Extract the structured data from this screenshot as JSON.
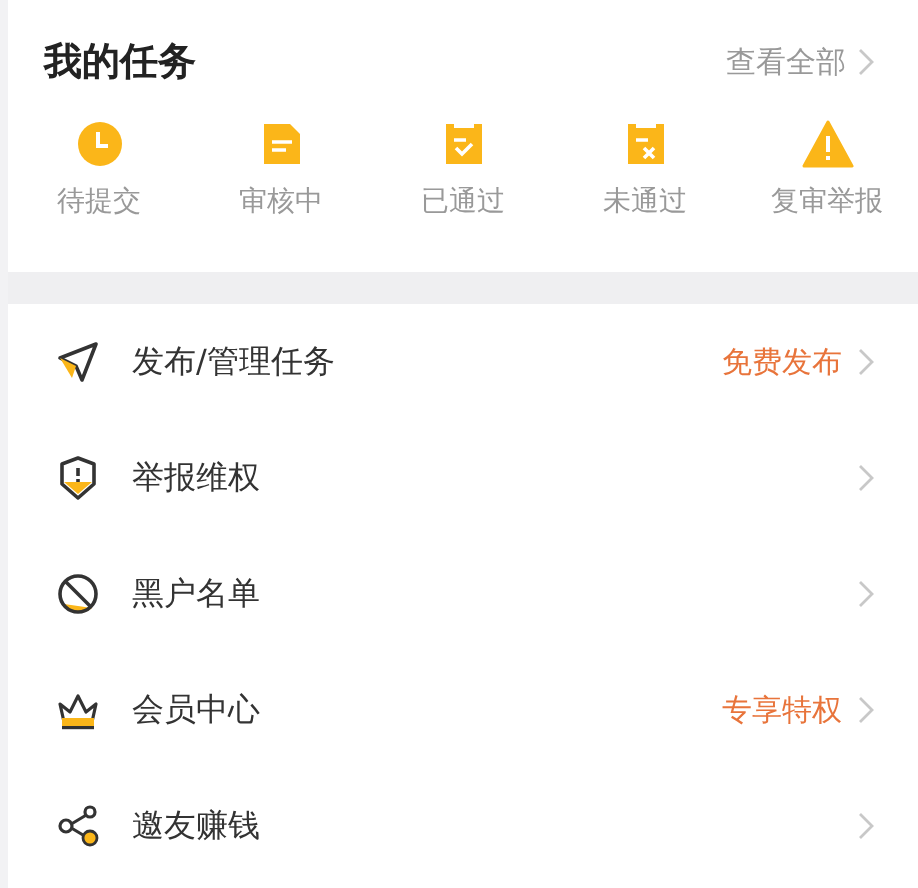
{
  "tasks": {
    "title": "我的任务",
    "view_all": "查看全部",
    "statuses": [
      {
        "kind": "clock",
        "label": "待提交"
      },
      {
        "kind": "doc",
        "label": "审核中"
      },
      {
        "kind": "passed",
        "label": "已通过"
      },
      {
        "kind": "failed",
        "label": "未通过"
      },
      {
        "kind": "warning",
        "label": "复审举报"
      }
    ]
  },
  "menu": [
    {
      "kind": "plane",
      "label": "发布/管理任务",
      "badge": "免费发布"
    },
    {
      "kind": "shield",
      "label": "举报维权"
    },
    {
      "kind": "ban",
      "label": "黑户名单"
    },
    {
      "kind": "crown",
      "label": "会员中心",
      "badge": "专享特权"
    },
    {
      "kind": "share",
      "label": "邀友赚钱"
    }
  ]
}
